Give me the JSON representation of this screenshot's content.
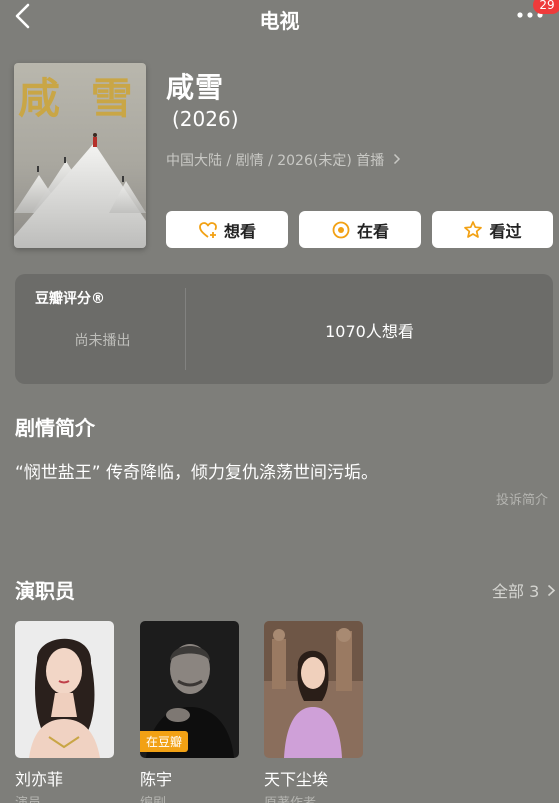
{
  "nav": {
    "title": "电视",
    "badge": "29"
  },
  "movie": {
    "title": "咸雪",
    "year": "(2026)",
    "meta": "中国大陆 / 剧情 / 2026(未定) 首播",
    "poster": {
      "calligraphy": "咸 雪"
    }
  },
  "actions": {
    "want": "想看",
    "watching": "在看",
    "watched": "看过"
  },
  "rating": {
    "label": "豆瓣评分®",
    "status": "尚未播出",
    "want_count": "1070人想看"
  },
  "synopsis": {
    "title": "剧情简介",
    "text": "“悯世盐王” 传奇降临，倾力复仇涤荡世间污垢。",
    "report": "投诉简介"
  },
  "cast": {
    "title": "演职员",
    "all_label": "全部 3",
    "members": [
      {
        "name": "刘亦菲",
        "role": "演员"
      },
      {
        "name": "陈宇",
        "role": "编剧",
        "tag": "在豆瓣"
      },
      {
        "name": "天下尘埃",
        "role": "原著作者"
      }
    ]
  },
  "colors": {
    "background": "#7e7e7a",
    "card": "#6c6c69",
    "badge": "#ee3b3b",
    "accent_orange": "#f2a114",
    "button_icon": "#f2a114"
  }
}
